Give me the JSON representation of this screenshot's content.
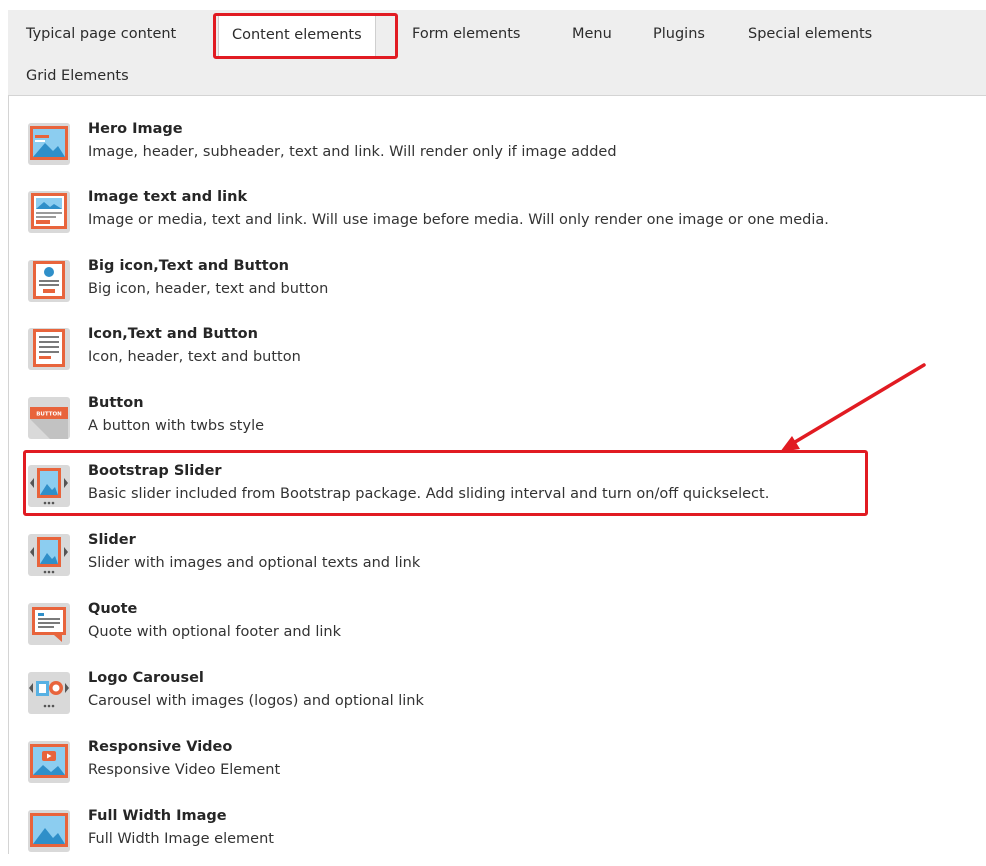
{
  "tabs": [
    {
      "label": "Typical page content"
    },
    {
      "label": "Content elements"
    },
    {
      "label": "Form elements"
    },
    {
      "label": "Menu"
    },
    {
      "label": "Plugins"
    },
    {
      "label": "Special elements"
    },
    {
      "label": "Grid Elements"
    }
  ],
  "active_tab": "Content elements",
  "items": [
    {
      "title": "Hero Image",
      "description": "Image, header, subheader, text and link. Will render only if image added",
      "icon": "hero-image-icon"
    },
    {
      "title": "Image text and link",
      "description": "Image or media, text and link. Will use image before media. Will only render one image or one media.",
      "icon": "image-text-link-icon"
    },
    {
      "title": "Big icon,Text and Button",
      "description": "Big icon, header, text and button",
      "icon": "big-icon-text-button-icon"
    },
    {
      "title": "Icon,Text and Button",
      "description": "Icon, header, text and button",
      "icon": "icon-text-button-icon"
    },
    {
      "title": "Button",
      "description": "A button with twbs style",
      "icon": "button-icon",
      "icon_text": "BUTTON"
    },
    {
      "title": "Bootstrap Slider",
      "description": "Basic slider included from Bootstrap package. Add sliding interval and turn on/off quickselect.",
      "icon": "slider-icon"
    },
    {
      "title": "Slider",
      "description": "Slider with images and optional texts and link",
      "icon": "slider-icon"
    },
    {
      "title": "Quote",
      "description": "Quote with optional footer and link",
      "icon": "quote-icon"
    },
    {
      "title": "Logo Carousel",
      "description": "Carousel with images (logos) and optional link",
      "icon": "logo-carousel-icon"
    },
    {
      "title": "Responsive Video",
      "description": "Responsive Video Element",
      "icon": "video-icon"
    },
    {
      "title": "Full Width Image",
      "description": "Full Width Image element",
      "icon": "full-width-image-icon"
    }
  ],
  "colors": {
    "icon_orange": "#e8643c",
    "icon_blue": "#58b1e3",
    "icon_gray": "#d9d9d9",
    "highlight_red": "#e11b22",
    "tabbar_bg": "#eeeeee"
  }
}
